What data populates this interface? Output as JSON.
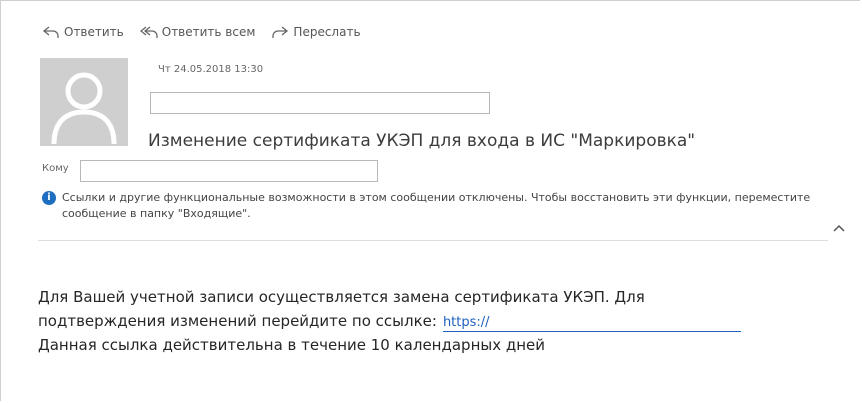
{
  "toolbar": {
    "reply_label": "Ответить",
    "reply_all_label": "Ответить всем",
    "forward_label": "Переслать"
  },
  "message": {
    "date": "Чт 24.05.2018 13:30",
    "subject": "Изменение сертификата УКЭП для входа в ИС \"Маркировка\"",
    "to_label": "Кому",
    "notice": "Ссылки и другие функциональные возможности в этом сообщении отключены. Чтобы восстановить эти функции, переместите сообщение в папку \"Входящие\".",
    "body": {
      "line1": "Для Вашей учетной записи осуществляется замена сертификата УКЭП. Для",
      "line2": "подтверждения изменений перейдите по ссылке:",
      "link": "https://",
      "line3": "Данная ссылка действительна в течение 10 календарных дней"
    }
  },
  "colors": {
    "link": "#1f5fbf",
    "info_icon": "#1e6fc0",
    "avatar_bg": "#cfcfcf"
  },
  "icons": {
    "reply": "reply-icon",
    "reply_all": "reply-all-icon",
    "forward": "forward-icon",
    "info": "info-icon",
    "collapse": "chevron-up-icon"
  }
}
